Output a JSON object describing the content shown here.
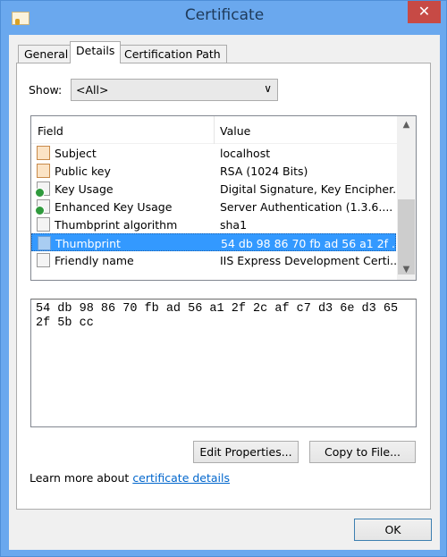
{
  "window": {
    "title": "Certificate",
    "close_glyph": "✕"
  },
  "tabs": [
    {
      "label": "General"
    },
    {
      "label": "Details",
      "active": true
    },
    {
      "label": "Certification Path"
    }
  ],
  "show": {
    "label": "Show:",
    "selected": "<All>"
  },
  "list": {
    "columns": [
      "Field",
      "Value"
    ],
    "rows": [
      {
        "icon": "certificate-field-icon",
        "field": "Subject",
        "value": "localhost"
      },
      {
        "icon": "certificate-field-icon",
        "field": "Public key",
        "value": "RSA (1024 Bits)"
      },
      {
        "icon": "extension-icon",
        "field": "Key Usage",
        "value": "Digital Signature, Key Encipher..."
      },
      {
        "icon": "extension-icon",
        "field": "Enhanced Key Usage",
        "value": "Server Authentication (1.3.6...."
      },
      {
        "icon": "property-icon",
        "field": "Thumbprint algorithm",
        "value": "sha1"
      },
      {
        "icon": "property-icon",
        "field": "Thumbprint",
        "value": "54 db 98 86 70 fb ad 56 a1 2f ...",
        "selected": true
      },
      {
        "icon": "property-icon",
        "field": "Friendly name",
        "value": "IIS Express Development Certi..."
      }
    ]
  },
  "detail_text": "54 db 98 86 70 fb ad 56 a1 2f 2c af c7 d3 6e d3 65 2f 5b cc",
  "buttons": {
    "edit_properties": "Edit Properties...",
    "copy_to_file": "Copy to File...",
    "ok": "OK"
  },
  "learn_more": {
    "prefix": "Learn more about ",
    "link": "certificate details"
  },
  "colors": {
    "selection": "#3399ff",
    "title_bar": "#6aa8ee",
    "close": "#c74a45",
    "link": "#0066cc"
  }
}
